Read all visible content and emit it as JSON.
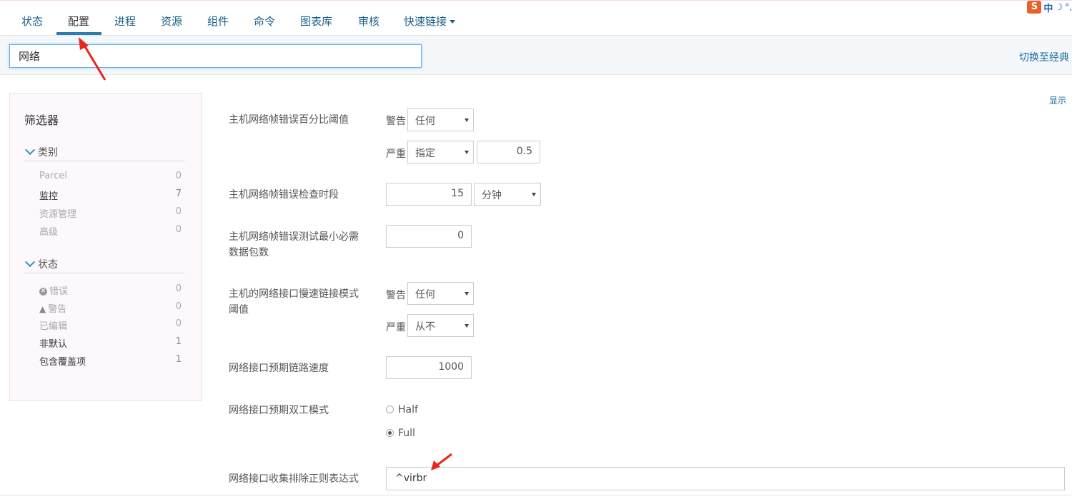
{
  "nav": {
    "tabs": [
      {
        "label": "状态"
      },
      {
        "label": "配置"
      },
      {
        "label": "进程"
      },
      {
        "label": "资源"
      },
      {
        "label": "组件"
      },
      {
        "label": "命令"
      },
      {
        "label": "图表库"
      },
      {
        "label": "审核"
      },
      {
        "label": "快速链接"
      }
    ],
    "active_tab": "配置"
  },
  "ime": {
    "brand": "S",
    "mode": "中"
  },
  "search": {
    "value": "网络"
  },
  "links": {
    "classic": "切换至经典",
    "display": "显示"
  },
  "filter": {
    "title": "筛选器",
    "category": {
      "heading": "类别",
      "items": [
        {
          "label": "Parcel",
          "count": "0"
        },
        {
          "label": "监控",
          "count": "7"
        },
        {
          "label": "资源管理",
          "count": "0"
        },
        {
          "label": "高级",
          "count": "0"
        }
      ]
    },
    "status": {
      "heading": "状态",
      "items": [
        {
          "label": "错误",
          "count": "0"
        },
        {
          "label": "警告",
          "count": "0"
        },
        {
          "label": "已编辑",
          "count": "0"
        },
        {
          "label": "非默认",
          "count": "1"
        },
        {
          "label": "包含覆盖项",
          "count": "1"
        }
      ]
    }
  },
  "settings": {
    "frame_error_pct": {
      "label": "主机网络帧错误百分比阈值",
      "warn_label": "警告",
      "warn_value": "任何",
      "crit_label": "严重",
      "crit_value": "指定",
      "crit_number": "0.5"
    },
    "frame_error_window": {
      "label": "主机网络帧错误检查时段",
      "value": "15",
      "unit": "分钟"
    },
    "min_packets": {
      "label_line1": "主机网络帧错误测试最小必需",
      "label_line2": "数据包数",
      "value": "0"
    },
    "slow_link": {
      "label_line1": "主机的网络接口慢速链接模式",
      "label_line2": "阈值",
      "warn_label": "警告",
      "warn_value": "任何",
      "crit_label": "严重",
      "crit_value": "从不"
    },
    "link_speed": {
      "label": "网络接口预期链路速度",
      "value": "1000"
    },
    "duplex": {
      "label": "网络接口预期双工模式",
      "options": [
        "Half",
        "Full"
      ],
      "selected": "Full"
    },
    "exclude_regex": {
      "label": "网络接口收集排除正则表达式",
      "value": "^virbr"
    }
  },
  "colors": {
    "accent": "#2d7bb3",
    "link": "#1a6aa0",
    "annotation": "#e8261c"
  }
}
